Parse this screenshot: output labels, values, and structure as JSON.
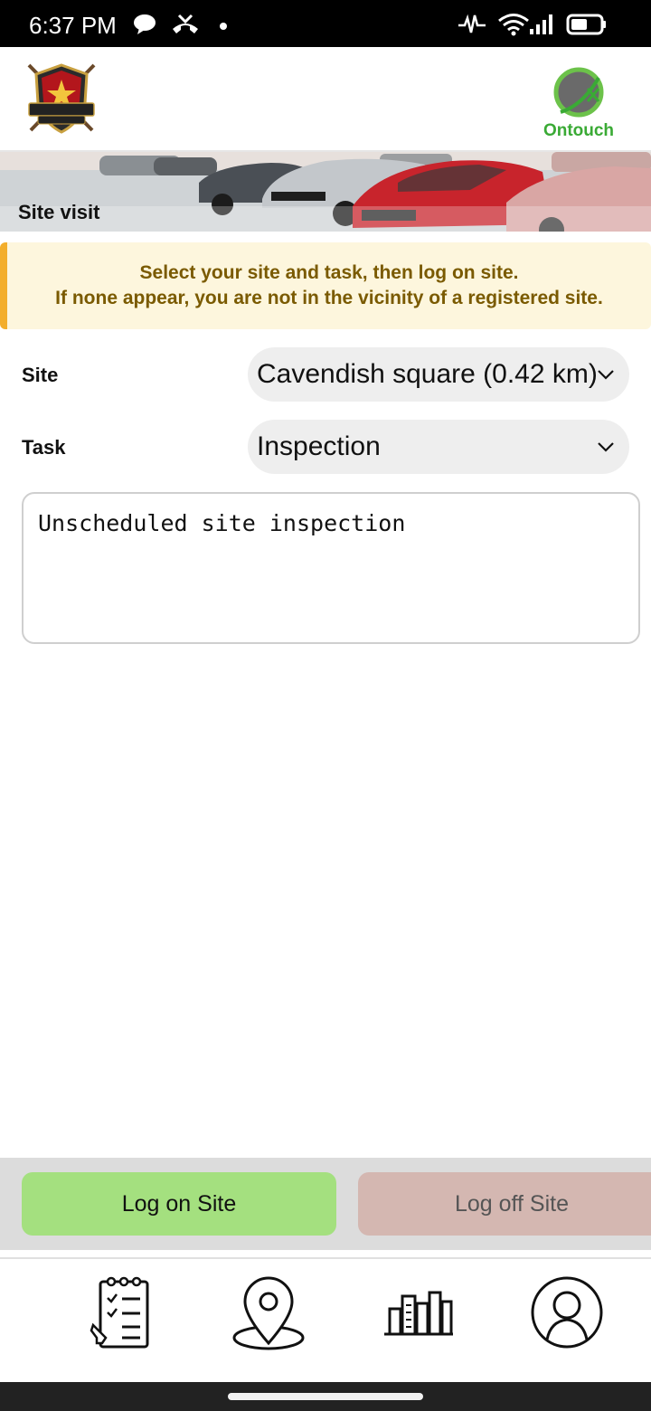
{
  "status_bar": {
    "time": "6:37 PM",
    "icons": [
      "chat-bubble-icon",
      "missed-call-icon",
      "dot-icon",
      "activity-icon",
      "wifi-icon",
      "signal-icon",
      "battery-icon"
    ]
  },
  "header": {
    "left_logo_text": "ROMAX SECURITY",
    "right_logo_text": "Ontouch"
  },
  "banner": {
    "title": "Site visit"
  },
  "notice": {
    "line1": "Select your site and task, then log on site.",
    "line2": "If none appear, you are not in the vicinity of a registered site."
  },
  "form": {
    "site_label": "Site",
    "site_value": "Cavendish square (0.42 km)",
    "task_label": "Task",
    "task_value": "Inspection",
    "notes_value": "Unscheduled site inspection"
  },
  "actions": {
    "log_on": "Log on Site",
    "log_off": "Log off Site"
  },
  "bottom_nav": {
    "items": [
      "checklist-icon",
      "location-pin-icon",
      "buildings-icon",
      "profile-icon"
    ]
  },
  "colors": {
    "notice_bg": "#fdf6dd",
    "notice_accent": "#f3ae2c",
    "notice_text": "#7a5a00",
    "log_on_bg": "#a4e07f",
    "log_off_bg": "#d4b7b1",
    "brand_green": "#3aaa35"
  }
}
